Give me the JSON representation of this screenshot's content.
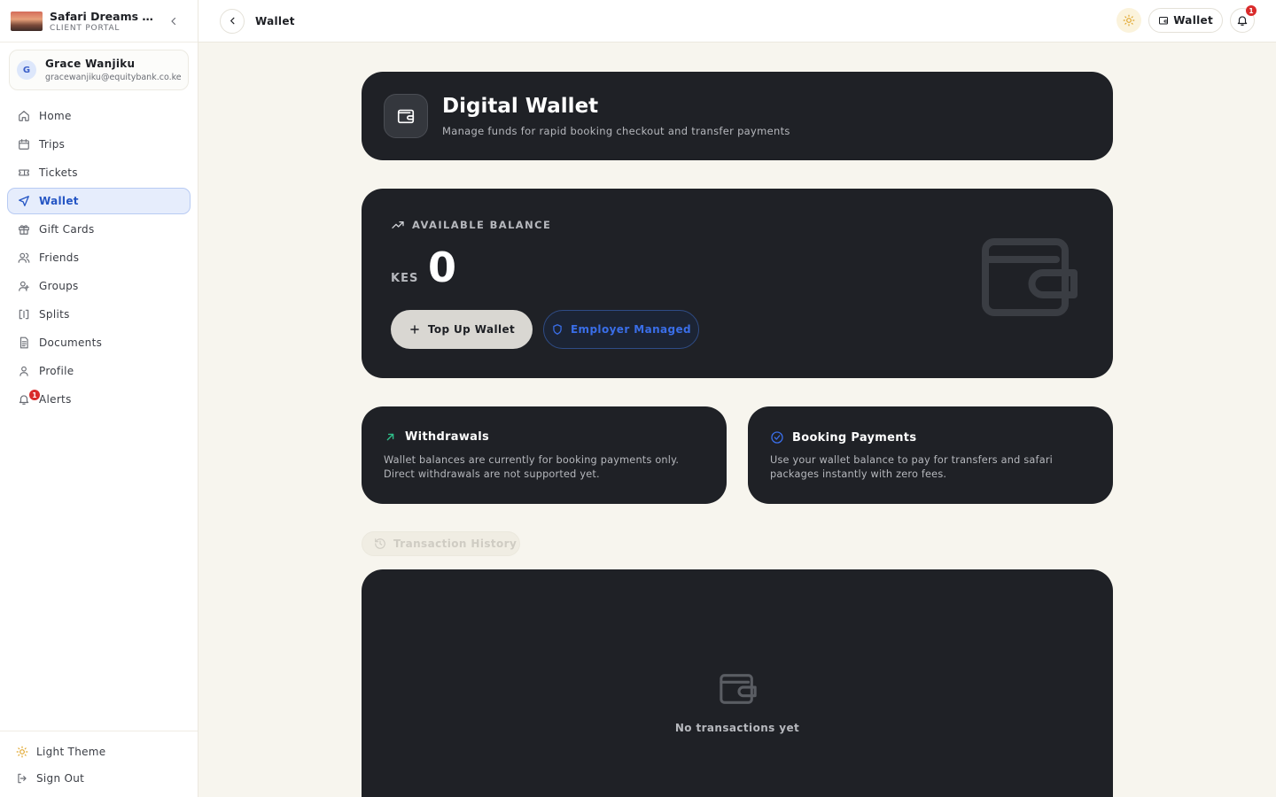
{
  "brand": {
    "title": "Safari Dreams Guides",
    "subtitle": "CLIENT PORTAL"
  },
  "user": {
    "initial": "G",
    "name": "Grace Wanjiku",
    "email": "gracewanjiku@equitybank.co.ke"
  },
  "nav": [
    {
      "label": "Home",
      "icon": "home-icon"
    },
    {
      "label": "Trips",
      "icon": "calendar-icon"
    },
    {
      "label": "Tickets",
      "icon": "ticket-icon"
    },
    {
      "label": "Wallet",
      "icon": "send-icon",
      "active": true
    },
    {
      "label": "Gift Cards",
      "icon": "gift-icon"
    },
    {
      "label": "Friends",
      "icon": "users-icon"
    },
    {
      "label": "Groups",
      "icon": "user-group-icon"
    },
    {
      "label": "Splits",
      "icon": "split-icon"
    },
    {
      "label": "Documents",
      "icon": "document-icon"
    },
    {
      "label": "Profile",
      "icon": "user-icon"
    },
    {
      "label": "Alerts",
      "icon": "bell-icon",
      "badge": "1"
    }
  ],
  "footer": {
    "theme_label": "Light Theme",
    "signout_label": "Sign Out"
  },
  "topbar": {
    "crumb": "Wallet",
    "wallet_label": "Wallet",
    "notification_count": "1"
  },
  "hero": {
    "title": "Digital Wallet",
    "subtitle": "Manage funds for rapid booking checkout and transfer payments"
  },
  "balance": {
    "label": "AVAILABLE BALANCE",
    "currency": "KES",
    "amount": "0",
    "topup_label": "Top Up Wallet",
    "employer_label": "Employer Managed"
  },
  "withdrawals": {
    "title": "Withdrawals",
    "body": "Wallet balances are currently for booking payments only. Direct withdrawals are not supported yet."
  },
  "booking_payments": {
    "title": "Booking Payments",
    "body": "Use your wallet balance to pay for transfers and safari packages instantly with zero fees."
  },
  "history": {
    "tab_label": "Transaction History",
    "empty_text": "No transactions yet"
  },
  "colors": {
    "accent": "#2455c4",
    "dark_card": "#1f2126",
    "background": "#f7f5ee",
    "badge": "#d92b2b",
    "success": "#2fbf8a"
  }
}
